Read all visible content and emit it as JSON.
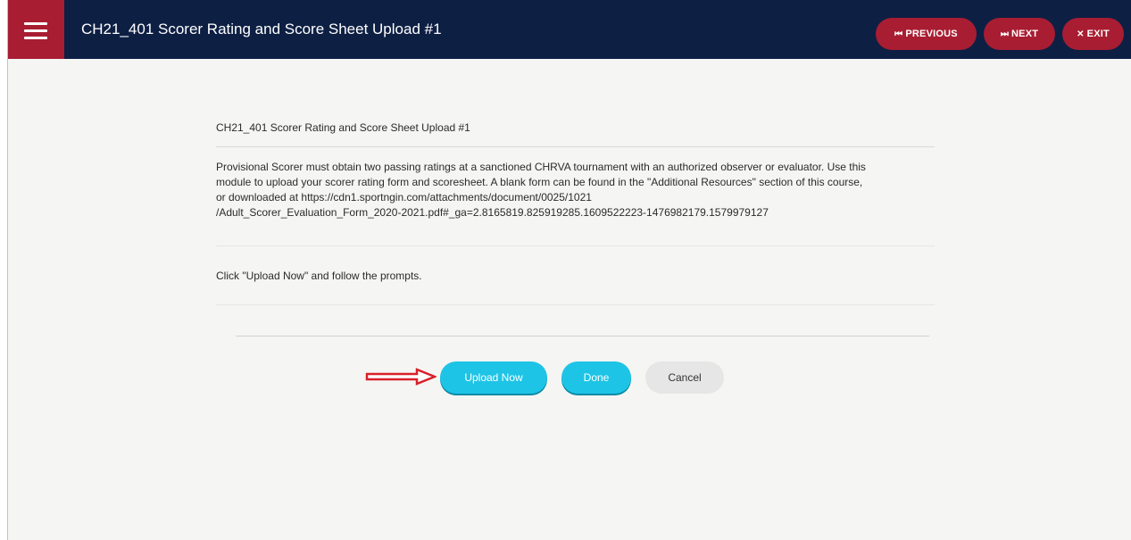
{
  "header": {
    "title": "CH21_401 Scorer Rating and Score Sheet Upload #1",
    "previous_label": "PREVIOUS",
    "next_label": "NEXT",
    "exit_label": "EXIT",
    "previous_icon": "⏮",
    "next_icon": "⏭",
    "exit_icon": "✕",
    "bar_color": "#0e1f44",
    "accent_color": "#a81d32"
  },
  "module": {
    "heading": "CH21_401 Scorer Rating and Score Sheet Upload #1",
    "description_lines": [
      "Provisional Scorer must obtain two passing ratings at a sanctioned CHRVA tournament with an authorized observer or evaluator. Use this",
      "module to upload your scorer rating form and scoresheet. A blank form can be found in the \"Additional Resources\" section of this course,",
      "or downloaded at https://cdn1.sportngin.com/attachments/document/0025/1021",
      "/Adult_Scorer_Evaluation_Form_2020-2021.pdf#_ga=2.8165819.825919285.1609522223-1476982179.1579979127"
    ],
    "instruction": "Click \"Upload Now\" and follow the prompts."
  },
  "actions": {
    "upload_label": "Upload Now",
    "done_label": "Done",
    "cancel_label": "Cancel",
    "primary_color": "#1ec4e6"
  },
  "annotation": {
    "arrow_icon": "red-right-arrow",
    "arrow_color": "#d8202a"
  }
}
